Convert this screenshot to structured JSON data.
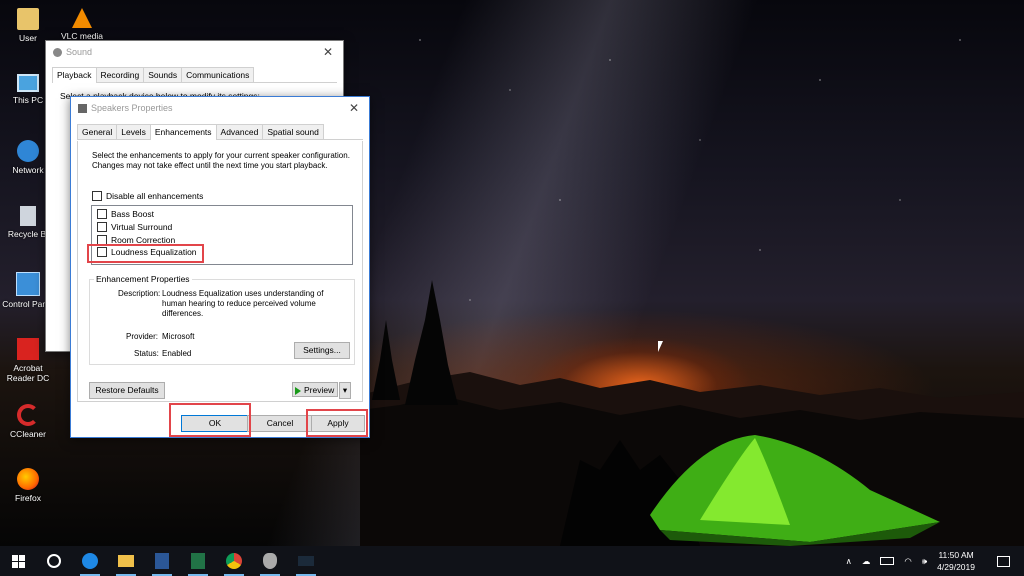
{
  "desktop_icons": [
    {
      "label": "User",
      "icon": "folder-user-icon"
    },
    {
      "label": "VLC media",
      "icon": "vlc-icon"
    },
    {
      "label": "This PC",
      "icon": "computer-icon"
    },
    {
      "label": "Network",
      "icon": "network-icon"
    },
    {
      "label": "Recycle Bi",
      "icon": "recycle-bin-icon"
    },
    {
      "label": "Control Panel",
      "icon": "control-panel-icon"
    },
    {
      "label": "Acrobat Reader DC",
      "icon": "acrobat-icon"
    },
    {
      "label": "CCleaner",
      "icon": "ccleaner-icon"
    },
    {
      "label": "Firefox",
      "icon": "firefox-icon"
    }
  ],
  "sound_window": {
    "title": "Sound",
    "tabs": [
      "Playback",
      "Recording",
      "Sounds",
      "Communications"
    ],
    "active_tab": "Playback",
    "partial_text": "Select a playback device below to modify its settings:"
  },
  "speakers_window": {
    "title": "Speakers Properties",
    "tabs": [
      "General",
      "Levels",
      "Enhancements",
      "Advanced",
      "Spatial sound"
    ],
    "active_tab": "Enhancements",
    "instructions": "Select the enhancements to apply for your current speaker configuration. Changes may not take effect until the next time you start playback.",
    "disable_all_label": "Disable all enhancements",
    "enhancements": [
      "Bass Boost",
      "Virtual Surround",
      "Room Correction",
      "Loudness Equalization"
    ],
    "properties_group_label": "Enhancement Properties",
    "description_label": "Description:",
    "description_value": "Loudness Equalization uses understanding of human hearing to reduce perceived volume differences.",
    "provider_label": "Provider:",
    "provider_value": "Microsoft",
    "status_label": "Status:",
    "status_value": "Enabled",
    "settings_button": "Settings...",
    "restore_button": "Restore Defaults",
    "preview_button": "Preview",
    "ok_button": "OK",
    "cancel_button": "Cancel",
    "apply_button": "Apply"
  },
  "taskbar": {
    "apps": [
      "windows-start-icon",
      "cortana-circle-icon",
      "edge-icon",
      "file-explorer-icon",
      "word-icon",
      "excel-icon",
      "chrome-icon",
      "app-icon",
      "window-thumbnail-icon"
    ],
    "time": "11:50 AM",
    "date": "4/29/2019"
  },
  "colors": {
    "highlight": "#e2454a",
    "taskbar": "#101218",
    "accent": "#76b9ed"
  }
}
